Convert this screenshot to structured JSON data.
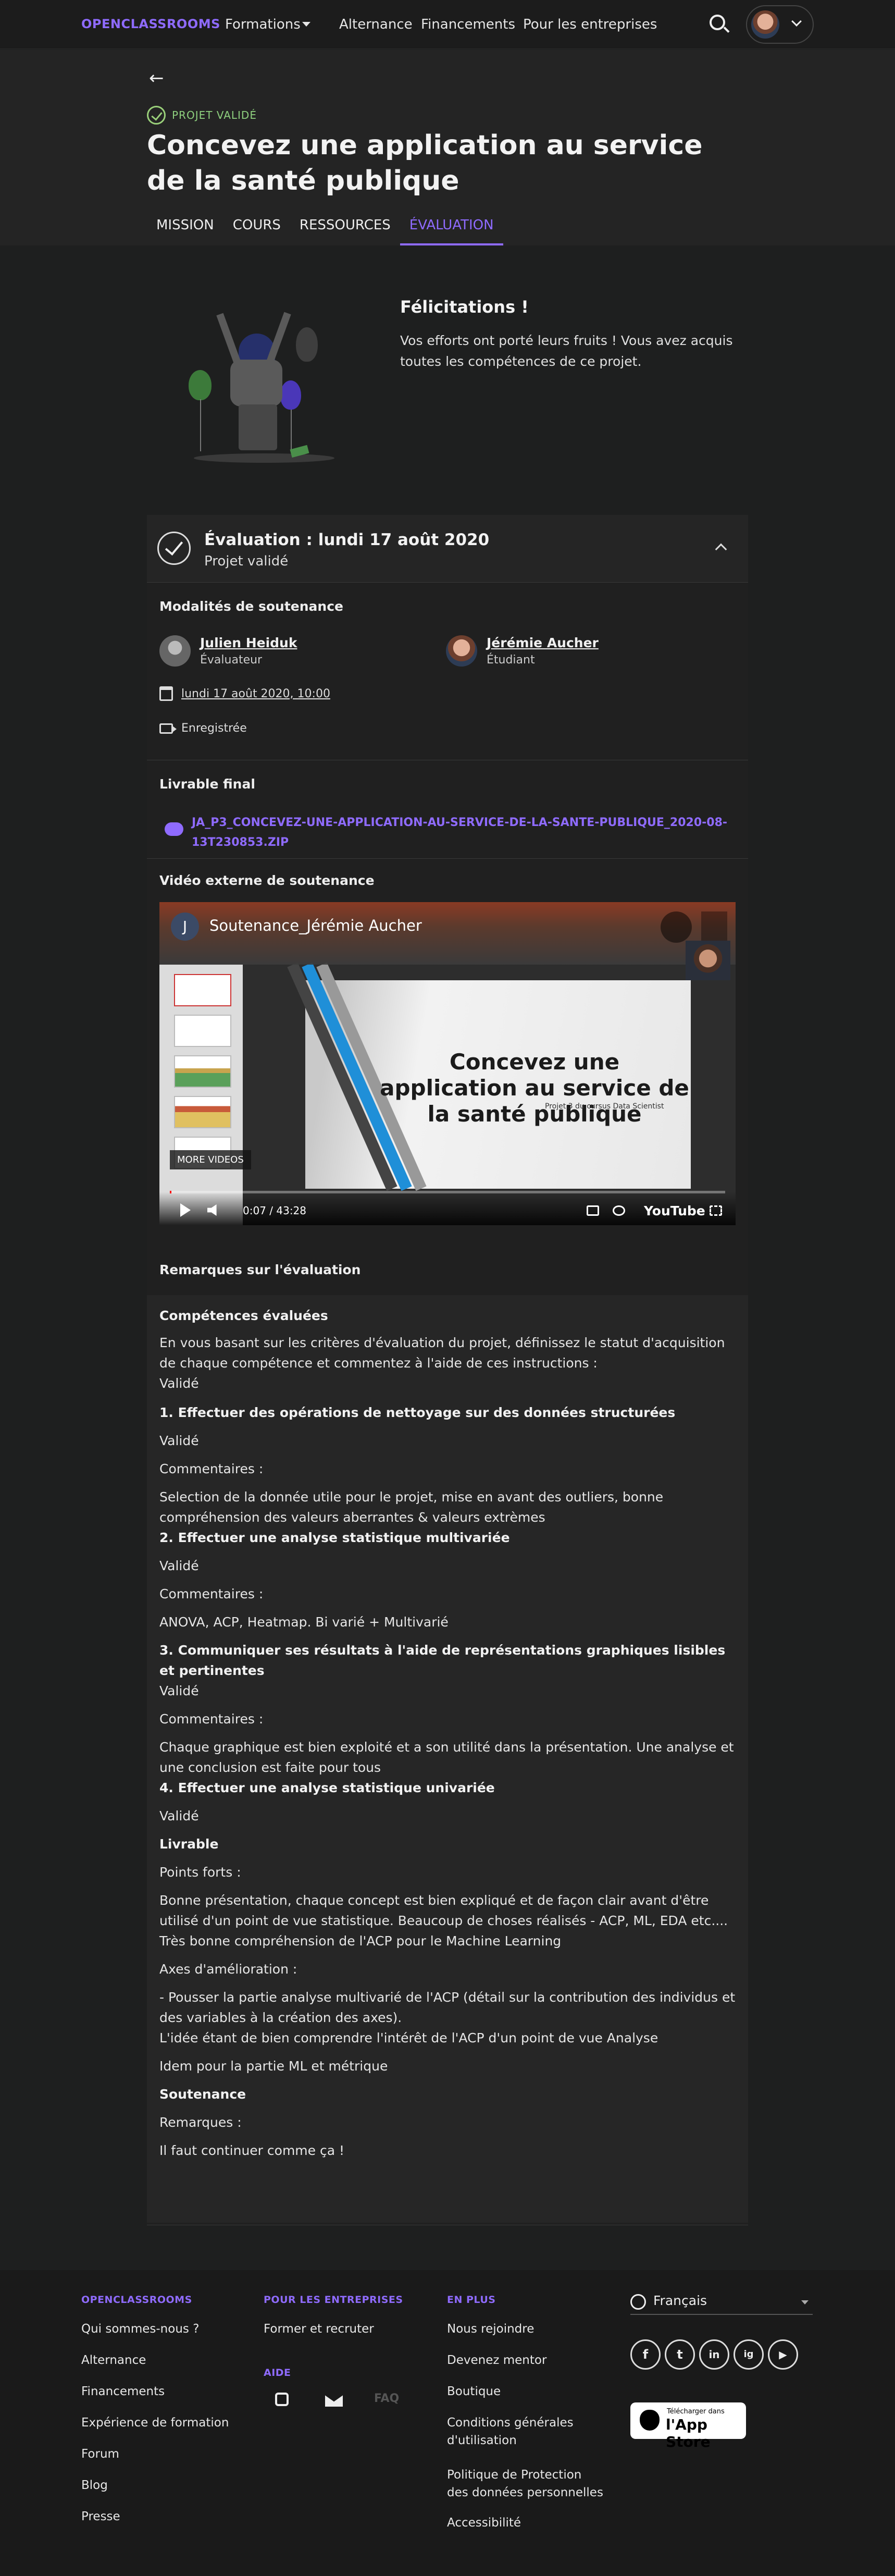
{
  "topnav": {
    "logo": "OPENCLASSROOMS",
    "formations": "Formations",
    "alternance": "Alternance",
    "financements": "Financements",
    "entreprises": "Pour les entreprises"
  },
  "project": {
    "back": "←",
    "status": "PROJET VALIDÉ",
    "title": "Concevez une application au service de la santé publique",
    "tabs": [
      "MISSION",
      "COURS",
      "RESSOURCES",
      "ÉVALUATION"
    ]
  },
  "congrats": {
    "title": "Félicitations !",
    "text": "Vos efforts ont porté leurs fruits ! Vous avez acquis toutes les compétences de ce projet."
  },
  "evaluation": {
    "title": "Évaluation : lundi 17 août 2020",
    "subtitle": "Projet validé"
  },
  "soutenance": {
    "title": "Modalités de soutenance",
    "evaluator_name": "Julien Heiduk",
    "evaluator_role": "Évaluateur",
    "student_name": "Jérémie Aucher",
    "student_role": "Étudiant",
    "date": "lundi 17 août 2020, 10:00",
    "recorded": "Enregistrée"
  },
  "livrable": {
    "title": "Livrable final",
    "file": "JA_P3_CONCEVEZ-UNE-APPLICATION-AU-SERVICE-DE-LA-SANTE-PUBLIQUE_2020-08-13T230853.ZIP"
  },
  "video": {
    "section_title": "Vidéo externe de soutenance",
    "channel_initial": "J",
    "title": "Soutenance_Jérémie Aucher",
    "slide_title": "Concevez une application au service de la santé publique",
    "slide_subtitle": "Projet 3 du cursus Data Scientist",
    "more_videos": "MORE VIDEOS",
    "time": "0:07 / 43:28",
    "youtube": "YouTube",
    "progress": 0.003
  },
  "remarks": {
    "title": "Remarques sur l'évaluation",
    "lines": [
      {
        "text": "Compétences évaluées",
        "bold": true
      },
      {
        "text": "En vous basant sur les critères d'évaluation du projet, définissez le statut d'acquisition de chaque compétence et commentez à l'aide de ces instructions :",
        "bold": false
      },
      {
        "text": "Validé",
        "bold": false
      },
      {
        "text": "1. Effectuer des opérations de nettoyage sur des données structurées",
        "bold": true
      },
      {
        "text": "Validé",
        "bold": false
      },
      {
        "text": "Commentaires :",
        "bold": false
      },
      {
        "text": "Selection de la donnée utile pour le projet, mise en avant des outliers, bonne compréhension des valeurs aberrantes & valeurs extrèmes",
        "bold": false
      },
      {
        "text": "2. Effectuer une analyse statistique multivariée",
        "bold": true
      },
      {
        "text": "Validé",
        "bold": false
      },
      {
        "text": "Commentaires :",
        "bold": false
      },
      {
        "text": "ANOVA, ACP, Heatmap. Bi varié + Multivarié",
        "bold": false
      },
      {
        "text": "3. Communiquer ses résultats à l'aide de représentations graphiques lisibles et pertinentes",
        "bold": true
      },
      {
        "text": "Validé",
        "bold": false
      },
      {
        "text": "Commentaires :",
        "bold": false
      },
      {
        "text": "Chaque graphique est bien exploité et a son utilité dans la présentation. Une analyse et une conclusion est faite pour tous",
        "bold": false
      },
      {
        "text": "4. Effectuer une analyse statistique univariée",
        "bold": true
      },
      {
        "text": "Validé",
        "bold": false
      },
      {
        "text": "Livrable",
        "bold": true
      },
      {
        "text": "Points forts :",
        "bold": false
      },
      {
        "text": "Bonne présentation, chaque concept est bien expliqué et de façon clair avant d'être utilisé d'un point de vue statistique. Beaucoup de choses réalisés - ACP, ML, EDA etc....",
        "bold": false
      },
      {
        "text": "Très bonne compréhension de l'ACP pour le Machine Learning",
        "bold": false
      },
      {
        "text": "Axes d'amélioration :",
        "bold": false
      },
      {
        "text": "- Pousser la partie analyse multivarié de l'ACP (détail sur la contribution des individus et des variables à la création des axes).",
        "bold": false
      },
      {
        "text": "L'idée étant de bien comprendre l'intérêt de l'ACP d'un point de vue Analyse",
        "bold": false
      },
      {
        "text": "Idem pour la partie ML et métrique",
        "bold": false
      },
      {
        "text": "Soutenance",
        "bold": true
      },
      {
        "text": "Remarques :",
        "bold": false
      },
      {
        "text": "Il faut continuer comme ça !",
        "bold": false
      }
    ]
  },
  "footer": {
    "col1_title": "OPENCLASSROOMS",
    "col1": [
      "Qui sommes-nous ?",
      "Alternance",
      "Financements",
      "Expérience de formation",
      "Forum",
      "Blog",
      "Presse"
    ],
    "col2_title": "POUR LES ENTREPRISES",
    "col2": [
      "Former et recruter"
    ],
    "aide_title": "AIDE",
    "faq": "FAQ",
    "col3_title": "EN PLUS",
    "col3": [
      "Nous rejoindre",
      "Devenez mentor",
      "Boutique",
      "Conditions générales d'utilisation",
      "Politique de Protection des données personnelles",
      "Accessibilité"
    ],
    "language": "Français",
    "social": [
      "f",
      "t",
      "in",
      "ig",
      "▶"
    ],
    "appstore_small": "Télécharger dans",
    "appstore_big": "l'App Store"
  }
}
